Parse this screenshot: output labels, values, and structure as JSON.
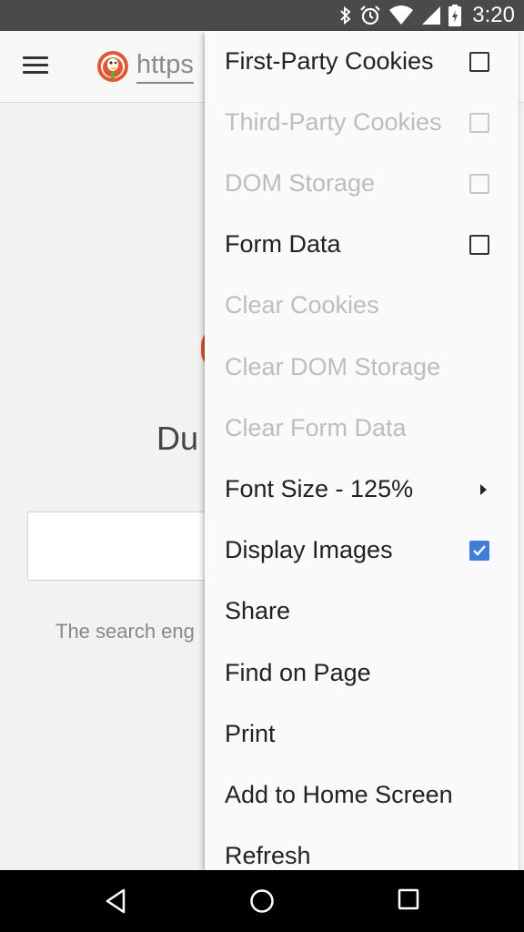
{
  "status_bar": {
    "time": "3:20",
    "icons": [
      "bluetooth-icon",
      "alarm-icon",
      "wifi-icon",
      "signal-icon",
      "battery-icon"
    ]
  },
  "toolbar": {
    "url_text": "https",
    "menu_icon": "hamburger-menu-icon",
    "logo_icon": "duckduckgo-logo-icon"
  },
  "page": {
    "title_fragment": "Du",
    "tagline_fragment": "The search eng"
  },
  "menu": {
    "items": [
      {
        "label": "First-Party Cookies",
        "enabled": true,
        "control": "checkbox",
        "checked": false
      },
      {
        "label": "Third-Party Cookies",
        "enabled": false,
        "control": "checkbox",
        "checked": false
      },
      {
        "label": "DOM Storage",
        "enabled": false,
        "control": "checkbox",
        "checked": false
      },
      {
        "label": "Form Data",
        "enabled": true,
        "control": "checkbox",
        "checked": false
      },
      {
        "label": "Clear Cookies",
        "enabled": false
      },
      {
        "label": "Clear DOM Storage",
        "enabled": false
      },
      {
        "label": "Clear Form Data",
        "enabled": false
      },
      {
        "label": "Font Size - 125%",
        "enabled": true,
        "control": "submenu"
      },
      {
        "label": "Display Images",
        "enabled": true,
        "control": "checkbox",
        "checked": true
      },
      {
        "label": "Share",
        "enabled": true
      },
      {
        "label": "Find on Page",
        "enabled": true
      },
      {
        "label": "Print",
        "enabled": true
      },
      {
        "label": "Add to Home Screen",
        "enabled": true
      },
      {
        "label": "Refresh",
        "enabled": true
      }
    ]
  },
  "nav_bar": {
    "buttons": [
      "back-icon",
      "home-icon",
      "recents-icon"
    ]
  },
  "colors": {
    "accent": "#3f7fd8",
    "logo": "#de5833",
    "status_bar": "#4a4a4a"
  }
}
